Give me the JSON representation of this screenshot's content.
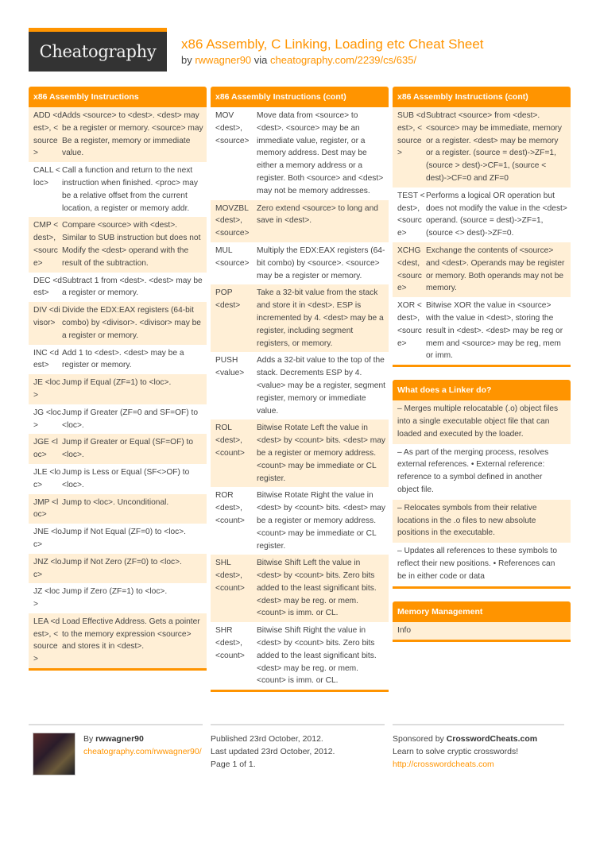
{
  "header": {
    "logo": "Cheatography",
    "title": "x86 Assembly, C Linking, Loading etc Cheat Sheet",
    "by_prefix": "by ",
    "author": "rwwagner90",
    "via": " via ",
    "url": "cheatography.com/2239/cs/635/"
  },
  "col1": {
    "title": "x86 Assembly Instructions",
    "rows": [
      {
        "k": "ADD <dest>, <source>",
        "v": "Adds <source> to <dest>. <dest> may be a register or memory. <source> may Be a register, memory or immediate value."
      },
      {
        "k": "CALL <loc>",
        "v": "Call a function and return to the next instruction when finished. <proc> may be a relative offset from the current location, a register or memory addr."
      },
      {
        "k": "CMP <dest>, <source>",
        "v": "Compare <source> with <dest>. Similar to SUB instruction but does not Modify the <dest> operand with the result of the subtraction."
      },
      {
        "k": "DEC <dest>",
        "v": "Subtract 1 from <dest>. <dest> may be a register or memory."
      },
      {
        "k": "DIV <divisor>",
        "v": "Divide the EDX:EAX registers (64-bit combo) by <divisor>. <divisor> may be a register or memory."
      },
      {
        "k": "INC <dest>",
        "v": "Add 1 to <dest>. <dest> may be a register or memory."
      },
      {
        "k": "JE <loc>",
        "v": "Jump if Equal (ZF=1) to <loc>."
      },
      {
        "k": "JG <loc>",
        "v": "Jump if Greater (ZF=0 and SF=OF) to <loc>."
      },
      {
        "k": "JGE <loc>",
        "v": "Jump if Greater or Equal (SF=OF) to <loc>."
      },
      {
        "k": "JLE <loc>",
        "v": "Jump is Less or Equal (SF<>OF) to <loc>."
      },
      {
        "k": "JMP <loc>",
        "v": "Jump to <loc>. Unconditional."
      },
      {
        "k": "JNE <loc>",
        "v": "Jump if Not Equal (ZF=0) to <loc>."
      },
      {
        "k": "JNZ <loc>",
        "v": "Jump if Not Zero (ZF=0) to <loc>."
      },
      {
        "k": "JZ <loc>",
        "v": "Jump if Zero (ZF=1) to <loc>."
      },
      {
        "k": "LEA <dest>, <source>",
        "v": "Load Effective Address. Gets a pointer to the memory expression <source> and stores it in <dest>."
      }
    ]
  },
  "col2": {
    "title": "x86 Assembly Instructions (cont)",
    "rows": [
      {
        "k": "MOV <dest>, <source>",
        "v": "Move data from <source> to <dest>. <source> may be an immediate value, register, or a memory address. Dest may be either a memory address or a register. Both <source> and <dest> may not be memory addresses."
      },
      {
        "k": "MOVZBL <dest>, <source>",
        "v": "Zero extend <source> to long and save in <dest>."
      },
      {
        "k": "MUL <source>",
        "v": "Multiply the EDX:EAX registers (64-bit combo) by <source>. <source> may be a register or memory."
      },
      {
        "k": "POP <dest>",
        "v": "Take a 32-bit value from the stack and store it in <dest>. ESP is incremented by 4. <dest> may be a register, including segment registers, or memory."
      },
      {
        "k": "PUSH <value>",
        "v": "Adds a 32-bit value to the top of the stack. Decrements ESP by 4. <value> may be a register, segment register, memory or immediate value."
      },
      {
        "k": "ROL <dest>, <count>",
        "v": "Bitwise Rotate Left the value in <dest> by <count> bits. <dest> may be a register or memory address. <count> may be immediate or CL register."
      },
      {
        "k": "ROR <dest>, <count>",
        "v": "Bitwise Rotate Right the value in <dest> by <count> bits. <dest> may be a register or memory address. <count> may be immediate or CL register."
      },
      {
        "k": "SHL <dest>, <count>",
        "v": "Bitwise Shift Left the value in <dest> by <count> bits. Zero bits added to the least significant bits. <dest> may be reg. or mem. <count> is imm. or CL."
      },
      {
        "k": "SHR <dest>, <count>",
        "v": "Bitwise Shift Right the value in <dest> by <count> bits. Zero bits added to the least significant bits. <dest> may be reg. or mem. <count> is imm. or CL."
      }
    ]
  },
  "col3": {
    "title": "x86 Assembly Instructions (cont)",
    "rows": [
      {
        "k": "SUB <dest>, <source>",
        "v": "Subtract <source> from <dest>. <source> may be immediate, memory or a register. <dest> may be memory or a register. (source = dest)->ZF=1, (source > dest)->CF=1, (source < dest)->CF=0 and ZF=0"
      },
      {
        "k": "TEST <dest>, <source>",
        "v": "Performs a logical OR operation but does not modify the value in the <dest> operand. (source = dest)->ZF=1, (source <> dest)->ZF=0."
      },
      {
        "k": "XCHG <dest, <source>",
        "v": "Exchange the contents of <source> and <dest>. Operands may be register or memory. Both operands may not be memory."
      },
      {
        "k": "XOR <dest>, <source>",
        "v": "Bitwise XOR the value in <source> with the value in <dest>, storing the result in <dest>. <dest> may be reg or mem and <source> may be reg, mem or imm."
      }
    ]
  },
  "linker": {
    "title": "What does a Linker do?",
    "paras": [
      "– Merges multiple relocatable (.o) object files into a single executable object file that can loaded and executed by the loader.",
      "– As part of the merging process, resolves external references. • External reference: reference to a symbol defined in another object file.",
      "– Relocates symbols from their relative locations in the .o files to new absolute positions in the executable.",
      "– Updates all references to these symbols to reflect their new positions. • References can be in either code or data"
    ]
  },
  "memory": {
    "title": "Memory Management",
    "paras": [
      "Info"
    ]
  },
  "footer": {
    "by_prefix": "By ",
    "author": "rwwagner90",
    "author_url": "cheatography.com/rwwagner90/",
    "published": "Published 23rd October, 2012.",
    "updated": "Last updated 23rd October, 2012.",
    "page": "Page 1 of 1.",
    "sponsored_prefix": "Sponsored by ",
    "sponsor": "CrosswordCheats.com",
    "sponsor_tagline": "Learn to solve cryptic crosswords!",
    "sponsor_url": "http://crosswordcheats.com"
  },
  "colors": {
    "accent": "#ff9400",
    "row_shade": "#ffefd6",
    "logo_bg": "#333333"
  }
}
